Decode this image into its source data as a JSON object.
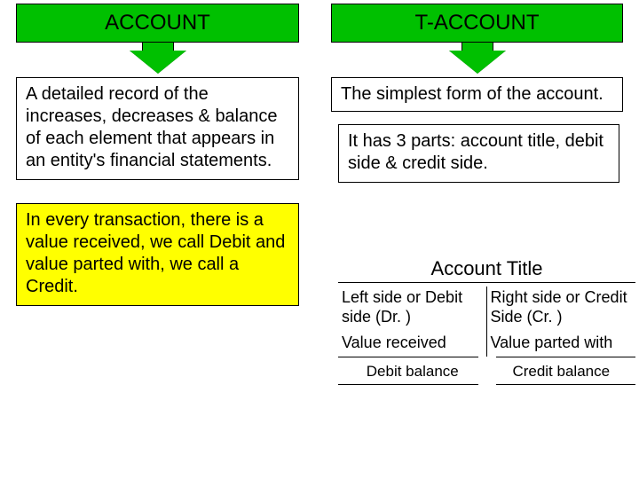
{
  "left": {
    "banner": "ACCOUNT",
    "def": "A detailed record of the increases, decreases & balance of each element that appears in an entity's financial statements.",
    "yellow": "In every transaction, there is a value received, we call Debit and value parted with, we call a Credit."
  },
  "right": {
    "banner": "T-ACCOUNT",
    "simplest": "The simplest form of the account.",
    "parts": "It has 3 parts: account title, debit side & credit side."
  },
  "t": {
    "title": "Account Title",
    "left_side": "Left side or Debit side (Dr. )",
    "right_side": "Right side or Credit Side (Cr. )",
    "left_val": "Value received",
    "right_val": "Value parted with",
    "left_bal": "Debit balance",
    "right_bal": "Credit balance"
  }
}
